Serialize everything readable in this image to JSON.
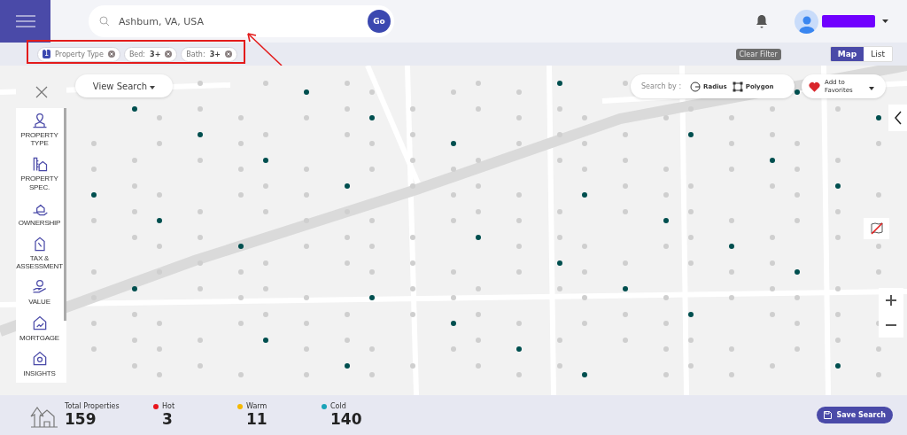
{
  "search": {
    "value": "Ashbum, VA, USA",
    "go_label": "Go"
  },
  "filters": [
    {
      "label": "Property Type",
      "count": "1"
    },
    {
      "label": "Bed:",
      "value": "3+"
    },
    {
      "label": "Bath:",
      "value": "3+"
    }
  ],
  "clear_filter": "Clear Filter",
  "view_toggle": [
    {
      "label": "Map",
      "selected": true
    },
    {
      "label": "List",
      "selected": false
    }
  ],
  "view_search": "View Search",
  "search_by": {
    "label": "Search by :",
    "options": [
      "Radius",
      "Polygon"
    ]
  },
  "favorites": "Add to Favorites",
  "sidebar": {
    "items": [
      {
        "label": "PROPERTY TYPE"
      },
      {
        "label": "PROPERTY SPEC."
      },
      {
        "label": "OWNERSHIP"
      },
      {
        "label": "TAX & ASSESSMENT"
      },
      {
        "label": "VALUE"
      },
      {
        "label": "MORTGAGE"
      },
      {
        "label": "INSIGHTS"
      }
    ]
  },
  "stats": [
    {
      "label": "Total Properties",
      "value": "159"
    },
    {
      "label": "Hot",
      "value": "3",
      "color": "#e8141c"
    },
    {
      "label": "Warm",
      "value": "11",
      "color": "#f5b800"
    },
    {
      "label": "Cold",
      "value": "140",
      "color": "#1aa3b8"
    }
  ],
  "save_search": "Save Search"
}
